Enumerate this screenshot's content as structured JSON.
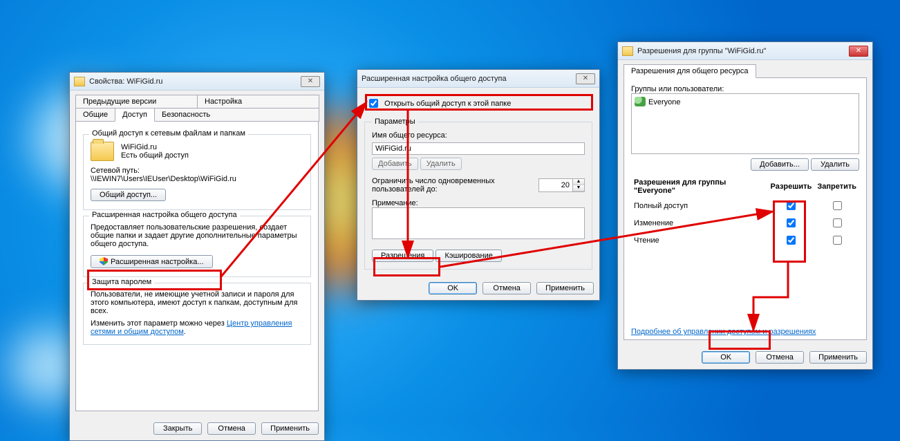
{
  "dlg1": {
    "title": "Свойства: WiFiGid.ru",
    "tabs": {
      "prev": "Предыдущие версии",
      "setup": "Настройка",
      "general": "Общие",
      "access": "Доступ",
      "security": "Безопасность"
    },
    "section1": {
      "title": "Общий доступ к сетевым файлам и папкам",
      "folderName": "WiFiGid.ru",
      "status": "Есть общий доступ",
      "pathLabel": "Сетевой путь:",
      "path": "\\\\IEWIN7\\Users\\IEUser\\Desktop\\WiFiGid.ru",
      "shareBtn": "Общий доступ..."
    },
    "section2": {
      "title": "Расширенная настройка общего доступа",
      "desc": "Предоставляет пользовательские разрешения, создает общие папки и задает другие дополнительные параметры общего доступа.",
      "advBtn": "Расширенная настройка..."
    },
    "section3": {
      "title": "Защита паролем",
      "desc": "Пользователи, не имеющие учетной записи и пароля для этого компьютера, имеют доступ к папкам, доступным для всех.",
      "change": "Изменить этот параметр можно через ",
      "link": "Центр управления сетями и общим доступом"
    },
    "buttons": {
      "close": "Закрыть",
      "cancel": "Отмена",
      "apply": "Применить"
    }
  },
  "dlg2": {
    "title": "Расширенная настройка общего доступа",
    "share": "Открыть общий доступ к этой папке",
    "params": "Параметры",
    "nameLabel": "Имя общего ресурса:",
    "name": "WiFiGid.ru",
    "add": "Добавить",
    "del": "Удалить",
    "limit": "Ограничить число одновременных пользователей до:",
    "limitVal": "20",
    "noteLabel": "Примечание:",
    "perm": "Разрешения",
    "cache": "Кэширование",
    "ok": "OK",
    "cancel": "Отмена",
    "apply": "Применить"
  },
  "dlg3": {
    "title": "Разрешения для группы \"WiFiGid.ru\"",
    "tab": "Разрешения для общего ресурса",
    "groupsLabel": "Группы или пользователи:",
    "user": "Everyone",
    "add": "Добавить...",
    "del": "Удалить",
    "permForLabel": "Разрешения для группы \"Everyone\"",
    "allow": "Разрешить",
    "deny": "Запретить",
    "rows": {
      "full": "Полный доступ",
      "change": "Изменение",
      "read": "Чтение"
    },
    "more": "Подробнее об управлении доступом и разрешениях",
    "ok": "OK",
    "cancel": "Отмена",
    "apply": "Применить"
  }
}
